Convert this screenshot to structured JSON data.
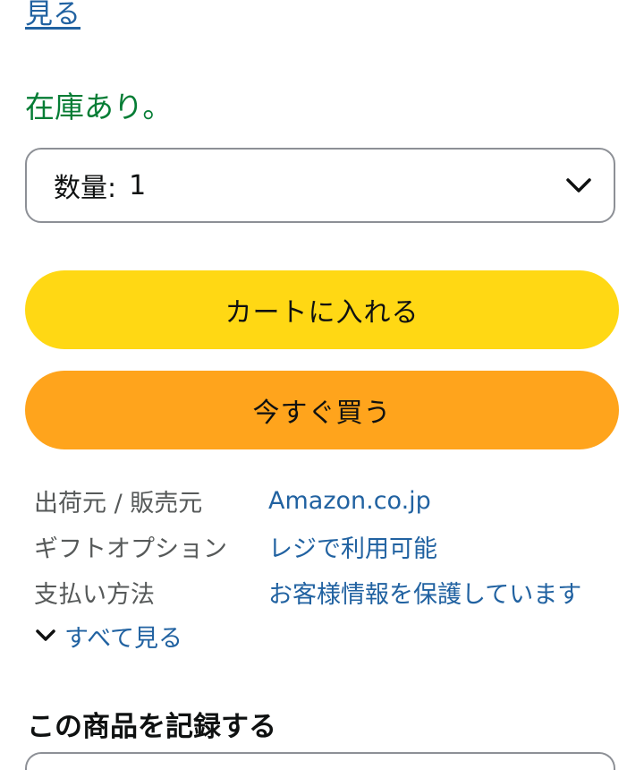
{
  "see_link": "見る",
  "stock_status": "在庫あり。",
  "quantity": {
    "label": "数量:",
    "value": "1",
    "icon": "chevron-down-icon"
  },
  "buttons": {
    "add_to_cart": "カートに入れる",
    "buy_now": "今すぐ買う"
  },
  "info": {
    "rows": [
      {
        "label": "出荷元 / 販売元",
        "value": "Amazon.co.jp"
      },
      {
        "label": "ギフトオプション",
        "value": "レジで利用可能"
      },
      {
        "label": "支払い方法",
        "value": "お客様情報を保護しています"
      }
    ],
    "see_all": "すべて見る"
  },
  "record_title": "この商品を記録する",
  "colors": {
    "link": "#2162a1",
    "in_stock": "#067d35",
    "cart_button": "#ffd814",
    "buy_button": "#ffa41c"
  }
}
